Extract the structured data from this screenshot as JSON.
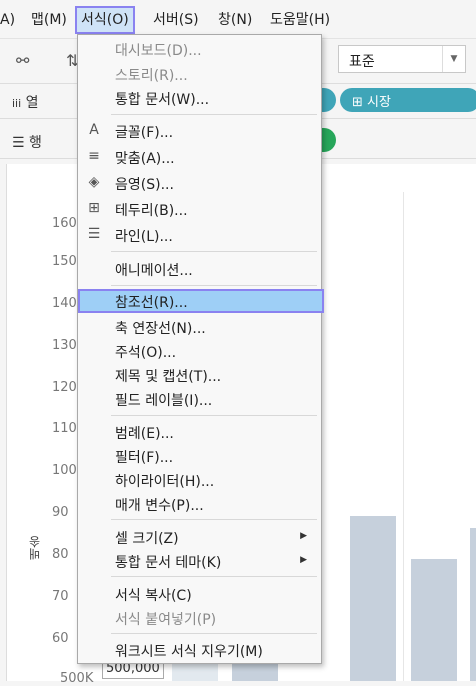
{
  "menubar": {
    "items": [
      {
        "label": "A)"
      },
      {
        "label": "맵(M)"
      },
      {
        "label": "서식(O)"
      },
      {
        "label": "서버(S)"
      },
      {
        "label": "창(N)"
      },
      {
        "label": "도움말(H)"
      }
    ]
  },
  "toolbar": {
    "mark_type": "표준"
  },
  "shelves": {
    "columns_label": "열",
    "rows_label": "행",
    "columns_pill": "⊞ 시장"
  },
  "chart": {
    "yaxis_title": "배송",
    "y_ticks": [
      "160",
      "150",
      "140",
      "130",
      "120",
      "110",
      "100",
      "90",
      "80",
      "70",
      "60",
      "500K"
    ],
    "value_label": "500,000"
  },
  "format_menu": {
    "items": [
      {
        "label": "대시보드(D)...",
        "enabled": false,
        "icon": ""
      },
      {
        "label": "스토리(R)...",
        "enabled": false,
        "icon": ""
      },
      {
        "label": "통합 문서(W)...",
        "enabled": true,
        "icon": ""
      },
      {
        "label": "글꼴(F)...",
        "enabled": true,
        "icon": "font-icon"
      },
      {
        "label": "맞춤(A)...",
        "enabled": true,
        "icon": "align-icon"
      },
      {
        "label": "음영(S)...",
        "enabled": true,
        "icon": "paint-bucket-icon"
      },
      {
        "label": "테두리(B)...",
        "enabled": true,
        "icon": "borders-icon"
      },
      {
        "label": "라인(L)...",
        "enabled": true,
        "icon": "lines-icon"
      },
      {
        "label": "애니메이션...",
        "enabled": true,
        "icon": ""
      },
      {
        "label": "참조선(R)...",
        "enabled": true,
        "icon": "",
        "highlighted": true
      },
      {
        "label": "축 연장선(N)...",
        "enabled": true,
        "icon": ""
      },
      {
        "label": "주석(O)...",
        "enabled": true,
        "icon": ""
      },
      {
        "label": "제목 및 캡션(T)...",
        "enabled": true,
        "icon": ""
      },
      {
        "label": "필드 레이블(I)...",
        "enabled": true,
        "icon": ""
      },
      {
        "label": "범례(E)...",
        "enabled": true,
        "icon": ""
      },
      {
        "label": "필터(F)...",
        "enabled": true,
        "icon": ""
      },
      {
        "label": "하이라이터(H)...",
        "enabled": true,
        "icon": ""
      },
      {
        "label": "매개 변수(P)...",
        "enabled": true,
        "icon": ""
      },
      {
        "label": "셀 크기(Z)",
        "enabled": true,
        "icon": "",
        "submenu": true
      },
      {
        "label": "통합 문서 테마(K)",
        "enabled": true,
        "icon": "",
        "submenu": true
      },
      {
        "label": "서식 복사(C)",
        "enabled": true,
        "icon": ""
      },
      {
        "label": "서식 붙여넣기(P)",
        "enabled": false,
        "icon": ""
      },
      {
        "label": "워크시트 서식 지우기(M)",
        "enabled": true,
        "icon": ""
      }
    ]
  }
}
